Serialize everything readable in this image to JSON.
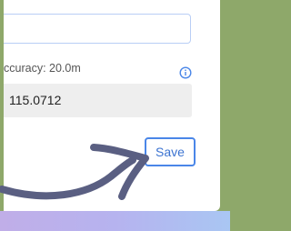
{
  "form": {
    "top_label": "",
    "accuracy_label": "ccuracy: 20.0m",
    "coordinate_value": "115.0712",
    "save_label": "Save"
  },
  "icons": {
    "info": "info-icon",
    "arrow": "curved-arrow-icon"
  },
  "colors": {
    "accent": "#4a86e8",
    "arrow": "#5a5f82",
    "background_frame": "#8ea86a"
  }
}
